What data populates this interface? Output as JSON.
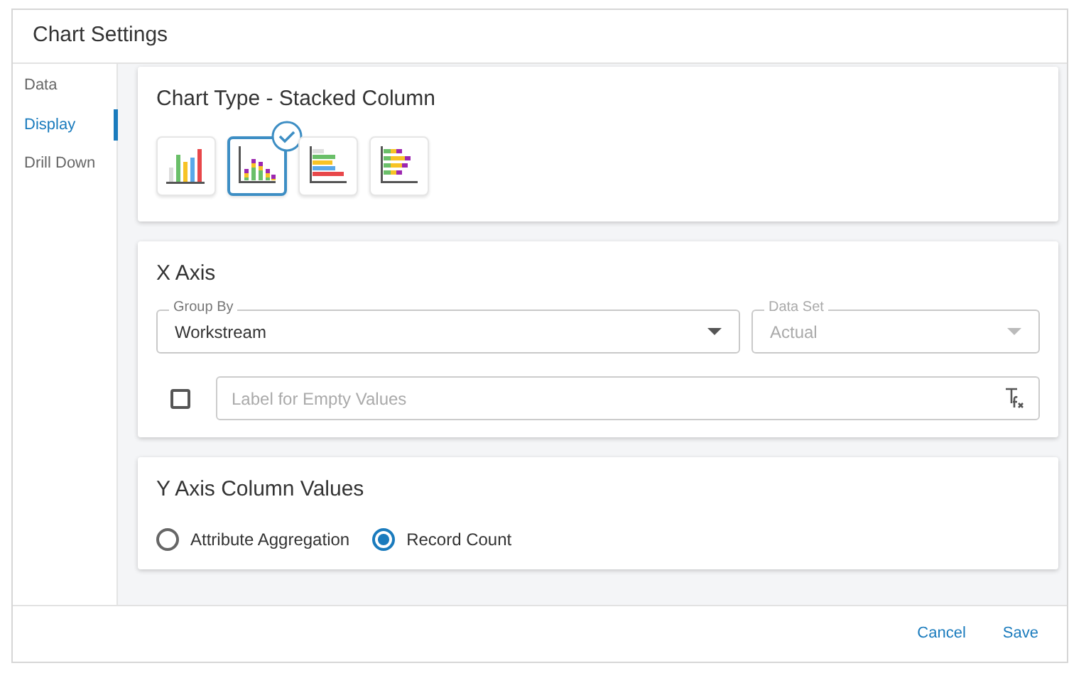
{
  "window": {
    "title": "Chart Settings"
  },
  "sidebar": {
    "items": [
      {
        "label": "Data",
        "selected": false
      },
      {
        "label": "Display",
        "selected": true
      },
      {
        "label": "Drill Down",
        "selected": false
      }
    ]
  },
  "chart_type": {
    "title": "Chart Type - Stacked Column",
    "options": [
      {
        "kind": "column",
        "selected": false
      },
      {
        "kind": "stacked-column",
        "selected": true
      },
      {
        "kind": "bar",
        "selected": false
      },
      {
        "kind": "stacked-bar",
        "selected": false
      }
    ]
  },
  "x_axis": {
    "title": "X Axis",
    "group_by": {
      "label": "Group By",
      "value": "Workstream",
      "disabled": false
    },
    "data_set": {
      "label": "Data Set",
      "value": "Actual",
      "disabled": true
    },
    "empty_label": {
      "checked": false,
      "placeholder": "Label for Empty Values"
    }
  },
  "y_axis": {
    "title": "Y Axis Column Values",
    "options": [
      {
        "label": "Attribute Aggregation",
        "selected": false
      },
      {
        "label": "Record Count",
        "selected": true
      }
    ]
  },
  "buttons": [
    {
      "label": "Cancel"
    },
    {
      "label": "Save"
    }
  ]
}
